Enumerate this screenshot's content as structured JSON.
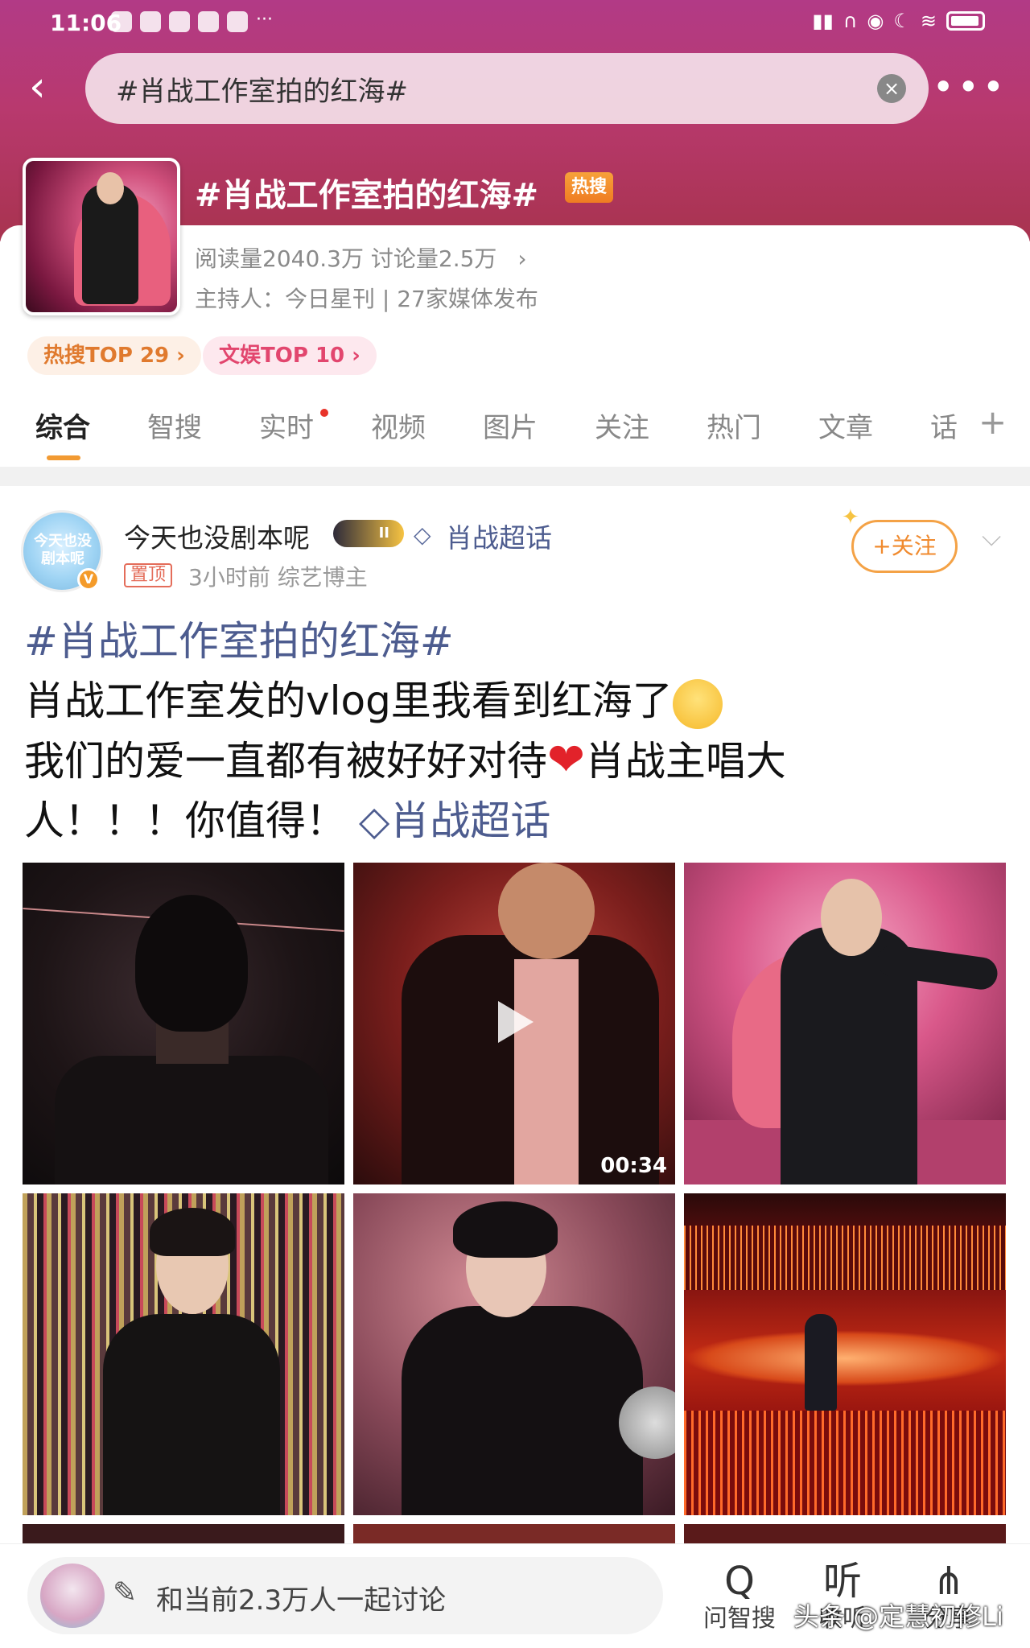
{
  "status_bar": {
    "time": "11:06",
    "more": "···"
  },
  "search": {
    "query": "#肖战工作室拍的红海#",
    "clear_icon": "×"
  },
  "header": {
    "back_icon": "‹",
    "more_icon": "•••"
  },
  "topic": {
    "title": "#肖战工作室拍的红海#",
    "hot_badge": "热搜",
    "stats": "阅读量2040.3万  讨论量2.5万",
    "stats_chevron": "›",
    "host": "主持人：今日星刊 | 27家媒体发布",
    "chips": [
      "热搜TOP 29 ›",
      "文娱TOP 10 ›"
    ]
  },
  "tabs": [
    "综合",
    "智搜",
    "实时",
    "视频",
    "图片",
    "关注",
    "热门",
    "文章",
    "话"
  ],
  "tabs_plus": "+",
  "post": {
    "avatar_text": "今天也没剧本呢",
    "verified_badge": "V",
    "username": "今天也没剧本呢",
    "crown_level": "II",
    "diamond_icon": "◇",
    "super_topic": "肖战超话",
    "pin_label": "置顶",
    "meta": "3小时前  综艺博主",
    "follow_label": "+关注",
    "follow_star": "✦",
    "dropdown_icon": "⌵",
    "hashtag": "#肖战工作室拍的红海#",
    "line1": "肖战工作室发的vlog里我看到红海了",
    "line2a": "我们的爱一直都有被好好对待",
    "heart": "❤",
    "line2b": "肖战主唱大",
    "line3": "人！！！你值得！",
    "link_icon": "◇",
    "link_text": "肖战超话",
    "video_duration": "00:34"
  },
  "bottom_bar": {
    "pencil_icon": "✎",
    "discuss_text": "和当前2.3万人一起讨论",
    "buttons": [
      {
        "icon": "Q",
        "label": "问智搜"
      },
      {
        "icon": "听",
        "label": "收听"
      },
      {
        "icon": "⋔",
        "label": "分享"
      }
    ]
  },
  "watermark": "头条 @定慧初修Li"
}
